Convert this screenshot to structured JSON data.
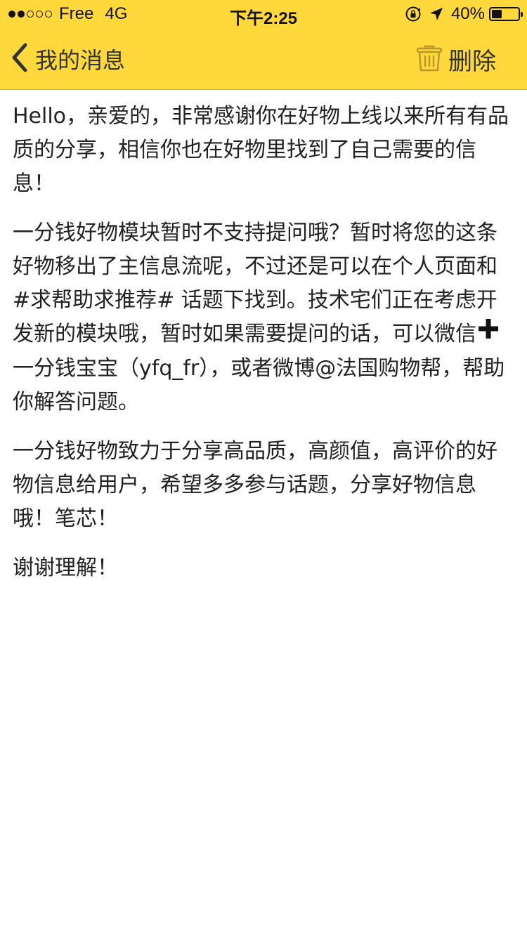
{
  "status_bar": {
    "carrier": "Free",
    "network": "4G",
    "time": "下午2:25",
    "battery_percent": "40%",
    "battery_level": 0.4,
    "signal_bars": 2,
    "signal_total": 5
  },
  "nav": {
    "back_label": "我的消息",
    "delete_label": "删除",
    "background_color": "#FFD83B",
    "icon_color": "#B8962A"
  },
  "message": {
    "p1": "Hello，亲爱的，非常感谢你在好物上线以来所有有品质的分享，相信你也在好物里找到了自己需要的信息！",
    "p2_before": "一分钱好物模块暂时不支持提问哦？暂时将您的这条好物移出了主信息流呢，不过还是可以在个人页面和 #求帮助求推荐# 话题下找到。技术宅们正在考虑开发新的模块哦，暂时如果需要提问的话，可以微信",
    "p2_after": "一分钱宝宝（yfq_fr），或者微博@法国购物帮，帮助你解答问题。",
    "p3": "一分钱好物致力于分享高品质，高颜值，高评价的好物信息给用户，希望多多参与话题，分享好物信息哦！笔芯！",
    "p4": "谢谢理解！"
  }
}
